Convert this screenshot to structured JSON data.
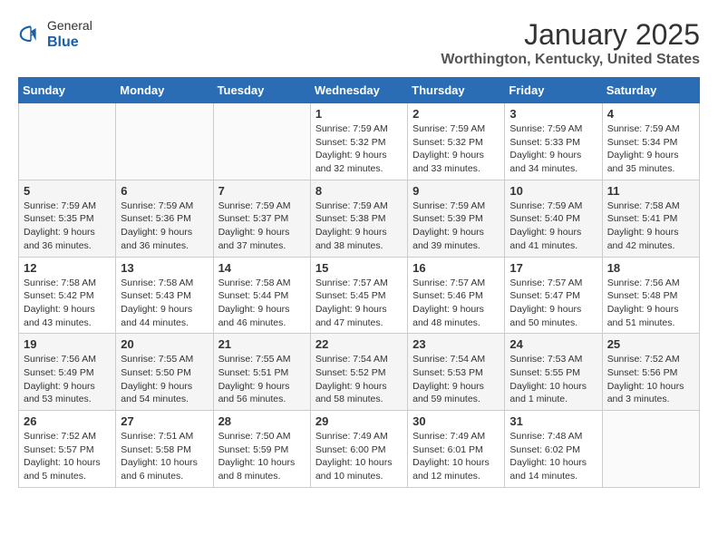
{
  "header": {
    "logo_line1": "General",
    "logo_line2": "Blue",
    "month_title": "January 2025",
    "location": "Worthington, Kentucky, United States"
  },
  "weekdays": [
    "Sunday",
    "Monday",
    "Tuesday",
    "Wednesday",
    "Thursday",
    "Friday",
    "Saturday"
  ],
  "weeks": [
    [
      {
        "day": "",
        "info": ""
      },
      {
        "day": "",
        "info": ""
      },
      {
        "day": "",
        "info": ""
      },
      {
        "day": "1",
        "info": "Sunrise: 7:59 AM\nSunset: 5:32 PM\nDaylight: 9 hours and 32 minutes."
      },
      {
        "day": "2",
        "info": "Sunrise: 7:59 AM\nSunset: 5:32 PM\nDaylight: 9 hours and 33 minutes."
      },
      {
        "day": "3",
        "info": "Sunrise: 7:59 AM\nSunset: 5:33 PM\nDaylight: 9 hours and 34 minutes."
      },
      {
        "day": "4",
        "info": "Sunrise: 7:59 AM\nSunset: 5:34 PM\nDaylight: 9 hours and 35 minutes."
      }
    ],
    [
      {
        "day": "5",
        "info": "Sunrise: 7:59 AM\nSunset: 5:35 PM\nDaylight: 9 hours and 36 minutes."
      },
      {
        "day": "6",
        "info": "Sunrise: 7:59 AM\nSunset: 5:36 PM\nDaylight: 9 hours and 36 minutes."
      },
      {
        "day": "7",
        "info": "Sunrise: 7:59 AM\nSunset: 5:37 PM\nDaylight: 9 hours and 37 minutes."
      },
      {
        "day": "8",
        "info": "Sunrise: 7:59 AM\nSunset: 5:38 PM\nDaylight: 9 hours and 38 minutes."
      },
      {
        "day": "9",
        "info": "Sunrise: 7:59 AM\nSunset: 5:39 PM\nDaylight: 9 hours and 39 minutes."
      },
      {
        "day": "10",
        "info": "Sunrise: 7:59 AM\nSunset: 5:40 PM\nDaylight: 9 hours and 41 minutes."
      },
      {
        "day": "11",
        "info": "Sunrise: 7:58 AM\nSunset: 5:41 PM\nDaylight: 9 hours and 42 minutes."
      }
    ],
    [
      {
        "day": "12",
        "info": "Sunrise: 7:58 AM\nSunset: 5:42 PM\nDaylight: 9 hours and 43 minutes."
      },
      {
        "day": "13",
        "info": "Sunrise: 7:58 AM\nSunset: 5:43 PM\nDaylight: 9 hours and 44 minutes."
      },
      {
        "day": "14",
        "info": "Sunrise: 7:58 AM\nSunset: 5:44 PM\nDaylight: 9 hours and 46 minutes."
      },
      {
        "day": "15",
        "info": "Sunrise: 7:57 AM\nSunset: 5:45 PM\nDaylight: 9 hours and 47 minutes."
      },
      {
        "day": "16",
        "info": "Sunrise: 7:57 AM\nSunset: 5:46 PM\nDaylight: 9 hours and 48 minutes."
      },
      {
        "day": "17",
        "info": "Sunrise: 7:57 AM\nSunset: 5:47 PM\nDaylight: 9 hours and 50 minutes."
      },
      {
        "day": "18",
        "info": "Sunrise: 7:56 AM\nSunset: 5:48 PM\nDaylight: 9 hours and 51 minutes."
      }
    ],
    [
      {
        "day": "19",
        "info": "Sunrise: 7:56 AM\nSunset: 5:49 PM\nDaylight: 9 hours and 53 minutes."
      },
      {
        "day": "20",
        "info": "Sunrise: 7:55 AM\nSunset: 5:50 PM\nDaylight: 9 hours and 54 minutes."
      },
      {
        "day": "21",
        "info": "Sunrise: 7:55 AM\nSunset: 5:51 PM\nDaylight: 9 hours and 56 minutes."
      },
      {
        "day": "22",
        "info": "Sunrise: 7:54 AM\nSunset: 5:52 PM\nDaylight: 9 hours and 58 minutes."
      },
      {
        "day": "23",
        "info": "Sunrise: 7:54 AM\nSunset: 5:53 PM\nDaylight: 9 hours and 59 minutes."
      },
      {
        "day": "24",
        "info": "Sunrise: 7:53 AM\nSunset: 5:55 PM\nDaylight: 10 hours and 1 minute."
      },
      {
        "day": "25",
        "info": "Sunrise: 7:52 AM\nSunset: 5:56 PM\nDaylight: 10 hours and 3 minutes."
      }
    ],
    [
      {
        "day": "26",
        "info": "Sunrise: 7:52 AM\nSunset: 5:57 PM\nDaylight: 10 hours and 5 minutes."
      },
      {
        "day": "27",
        "info": "Sunrise: 7:51 AM\nSunset: 5:58 PM\nDaylight: 10 hours and 6 minutes."
      },
      {
        "day": "28",
        "info": "Sunrise: 7:50 AM\nSunset: 5:59 PM\nDaylight: 10 hours and 8 minutes."
      },
      {
        "day": "29",
        "info": "Sunrise: 7:49 AM\nSunset: 6:00 PM\nDaylight: 10 hours and 10 minutes."
      },
      {
        "day": "30",
        "info": "Sunrise: 7:49 AM\nSunset: 6:01 PM\nDaylight: 10 hours and 12 minutes."
      },
      {
        "day": "31",
        "info": "Sunrise: 7:48 AM\nSunset: 6:02 PM\nDaylight: 10 hours and 14 minutes."
      },
      {
        "day": "",
        "info": ""
      }
    ]
  ]
}
